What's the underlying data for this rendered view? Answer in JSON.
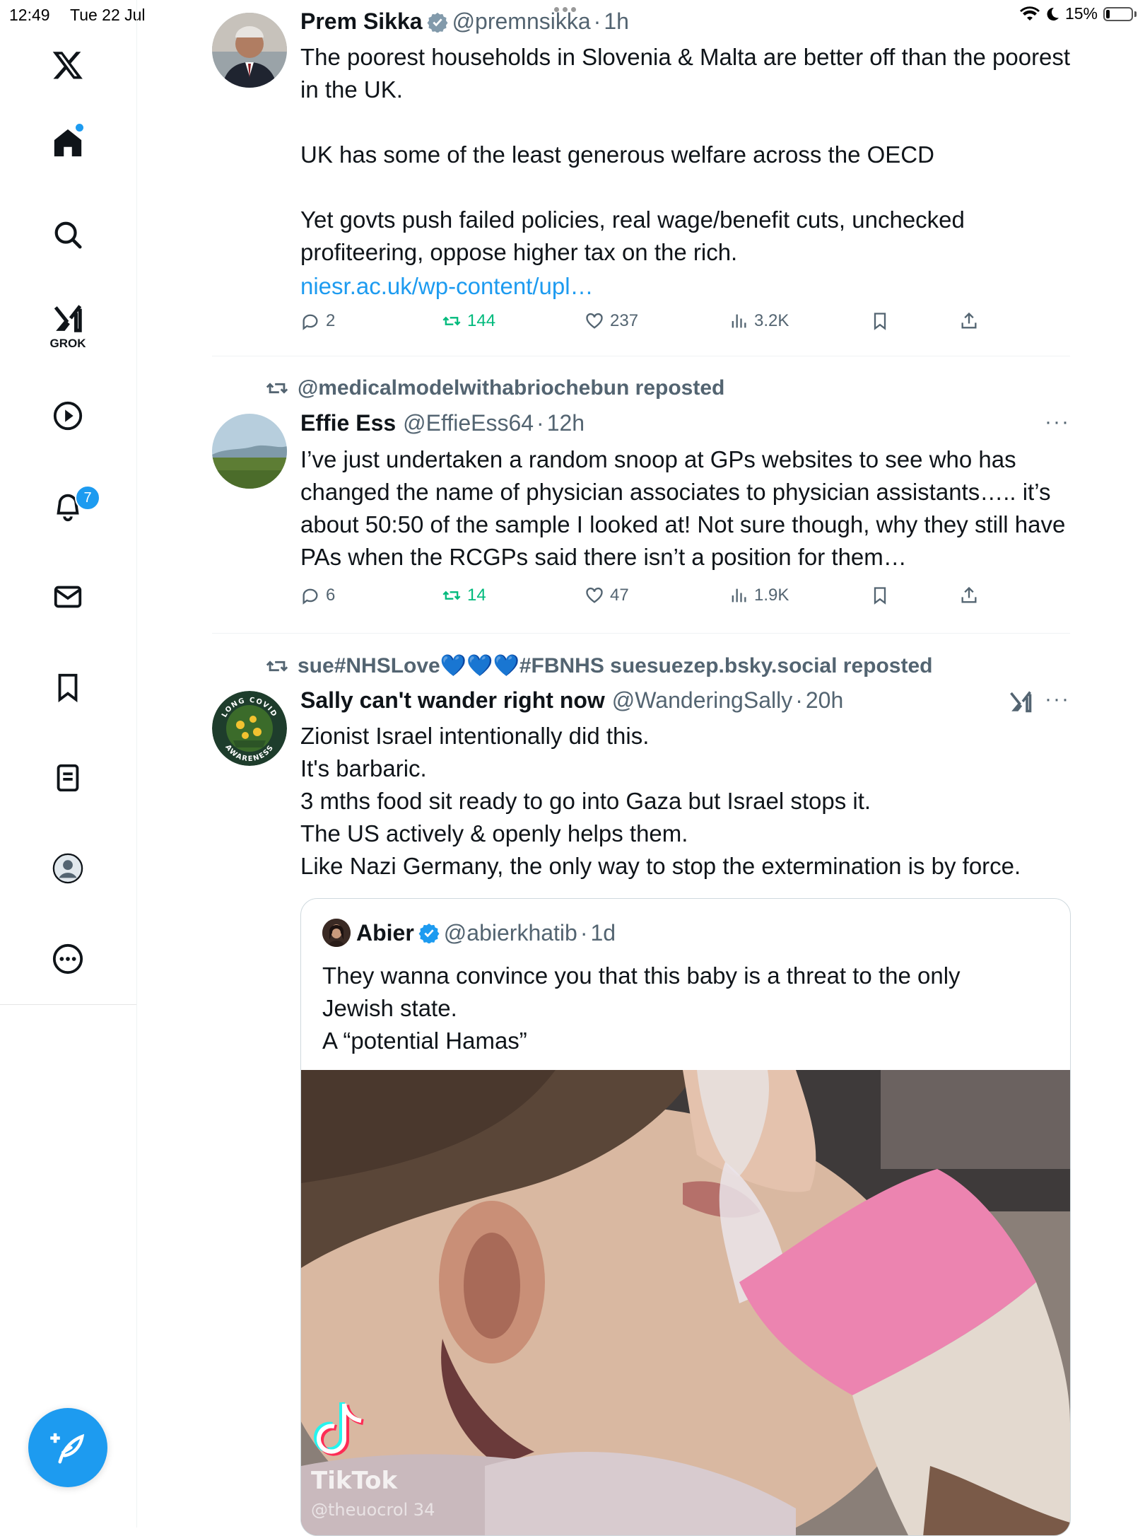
{
  "status_bar": {
    "time": "12:49",
    "date": "Tue 22 Jul",
    "battery": "15%",
    "battery_level": 0.15
  },
  "sidebar": {
    "items": [
      {
        "name": "x-logo"
      },
      {
        "name": "home"
      },
      {
        "name": "search"
      },
      {
        "name": "grok",
        "label": "GROK"
      },
      {
        "name": "video"
      },
      {
        "name": "notifications"
      },
      {
        "name": "messages"
      },
      {
        "name": "bookmarks"
      },
      {
        "name": "lists"
      },
      {
        "name": "profile"
      },
      {
        "name": "more"
      }
    ],
    "notifications_badge": "7"
  },
  "posts": [
    {
      "name": "Prem Sikka",
      "handle": "@premnsikka",
      "dot": "·",
      "time": "1h",
      "text": "The poorest households in Slovenia & Malta are better off than the poorest in the UK.\n\nUK has some of the least generous welfare across the OECD\n\nYet govts push failed policies, real wage/benefit cuts, unchecked profiteering, oppose higher tax on the rich.",
      "link": "niesr.ac.uk/wp-content/upl…",
      "replies": "2",
      "reposts": "144",
      "likes": "237",
      "views": "3.2K"
    },
    {
      "repost_by": "@medicalmodelwithabriochebun reposted",
      "name": "Effie Ess",
      "handle": "@EffieEss64",
      "dot": "·",
      "time": "12h",
      "text": "I’ve just undertaken a random snoop at GPs websites to see who has changed the name of physician associates to physician assistants….. it’s about 50:50 of the sample I looked at! Not sure though, why they still have PAs when the RCGPs said there isn’t a position for them…",
      "replies": "6",
      "reposts": "14",
      "likes": "47",
      "views": "1.9K"
    },
    {
      "repost_by_prefix": "sue#NHSLove",
      "repost_by_hearts": "💙💙💙",
      "repost_by_suffix": "#FBNHS suesuezep.bsky.social reposted",
      "name": "Sally can't wander right now",
      "handle": "@WanderingSally",
      "dot": "·",
      "time": "20h",
      "text": "Zionist Israel intentionally did this.\nIt's barbaric.\n3 mths food sit ready to go into Gaza but Israel stops it.\nThe US actively & openly helps them.\nLike Nazi Germany, the only way to stop the extermination is by force.",
      "avatar_ring_text_top": "LONG COVID",
      "avatar_ring_text_bottom": "AWARENESS",
      "quote": {
        "name": "Abier",
        "handle": "@abierkhatib",
        "dot": "·",
        "time": "1d",
        "text": "They wanna convince you that this baby is a threat to the only Jewish state.\nA “potential Hamas”",
        "media_watermark": "TikTok",
        "media_watermark_handle": "@theuocrol 34"
      }
    }
  ],
  "colors": {
    "accent": "#1d9bf0",
    "repost_green": "#00ba7c",
    "muted": "#536471"
  }
}
